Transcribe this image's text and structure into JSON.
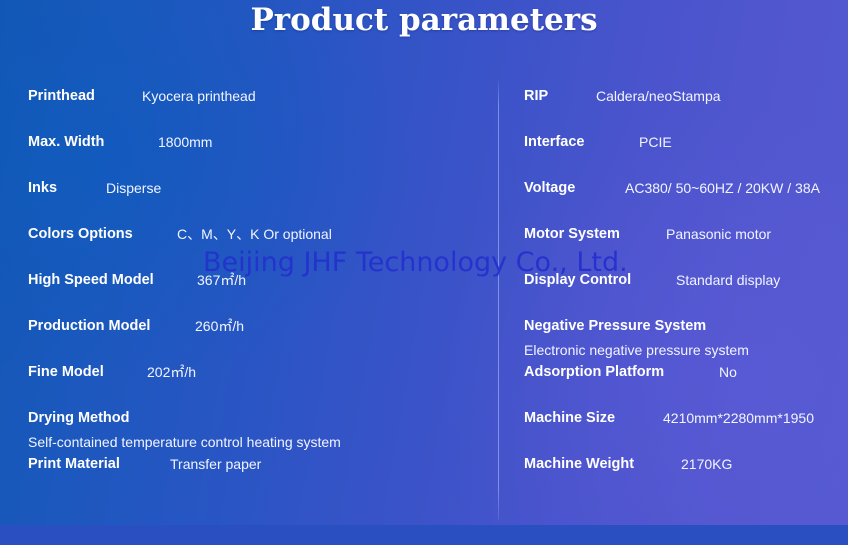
{
  "title": "Product parameters",
  "watermark": "Beijing JHF Technology Co., Ltd.",
  "colors": {
    "gradient_start": "#1257b4",
    "gradient_end": "#5459d0",
    "title_text": "#ffffff",
    "label_text": "#ffffff",
    "value_text": "#f2f5ff",
    "watermark_text": "#2430cf",
    "divider": "#becdf5"
  },
  "columns": {
    "left": [
      {
        "label": "Printhead",
        "value": "Kyocera printhead",
        "indent": 114,
        "layout": "inline"
      },
      {
        "label": "Max. Width",
        "value": "1800mm",
        "indent": 130,
        "layout": "inline"
      },
      {
        "label": "Inks",
        "value": "Disperse",
        "indent": 78,
        "layout": "inline"
      },
      {
        "label": "Colors Options",
        "value": "C、M、Y、K Or optional",
        "indent": 149,
        "layout": "inline"
      },
      {
        "label": "High Speed Model",
        "value": "367㎡/h",
        "indent": 169,
        "layout": "inline"
      },
      {
        "label": "Production Model",
        "value": "260㎡/h",
        "indent": 167,
        "layout": "inline"
      },
      {
        "label": "Fine Model",
        "value": "202㎡/h",
        "indent": 119,
        "layout": "inline"
      },
      {
        "label": "Drying Method",
        "value": "Self-contained temperature control heating system",
        "indent": 0,
        "layout": "below"
      },
      {
        "label": "Print Material",
        "value": "Transfer paper",
        "indent": 142,
        "layout": "inline"
      }
    ],
    "right": [
      {
        "label": "RIP",
        "value": "Caldera/neoStampa",
        "indent": 72,
        "layout": "inline"
      },
      {
        "label": "Interface",
        "value": "PCIE",
        "indent": 115,
        "layout": "inline"
      },
      {
        "label": "Voltage",
        "value": "AC380/ 50~60HZ / 20KW / 38A",
        "indent": 101,
        "layout": "inline"
      },
      {
        "label": "Motor System",
        "value": "Panasonic motor",
        "indent": 142,
        "layout": "inline"
      },
      {
        "label": "Display Control",
        "value": "Standard display",
        "indent": 152,
        "layout": "inline"
      },
      {
        "label": "Negative Pressure System",
        "value": "Electronic negative pressure system",
        "indent": 0,
        "layout": "below"
      },
      {
        "label": "Adsorption Platform",
        "value": "No",
        "indent": 195,
        "layout": "inline"
      },
      {
        "label": "Machine Size",
        "value": "4210mm*2280mm*1950",
        "indent": 139,
        "layout": "inline"
      },
      {
        "label": "Machine Weight",
        "value": "2170KG",
        "indent": 157,
        "layout": "inline"
      }
    ]
  }
}
